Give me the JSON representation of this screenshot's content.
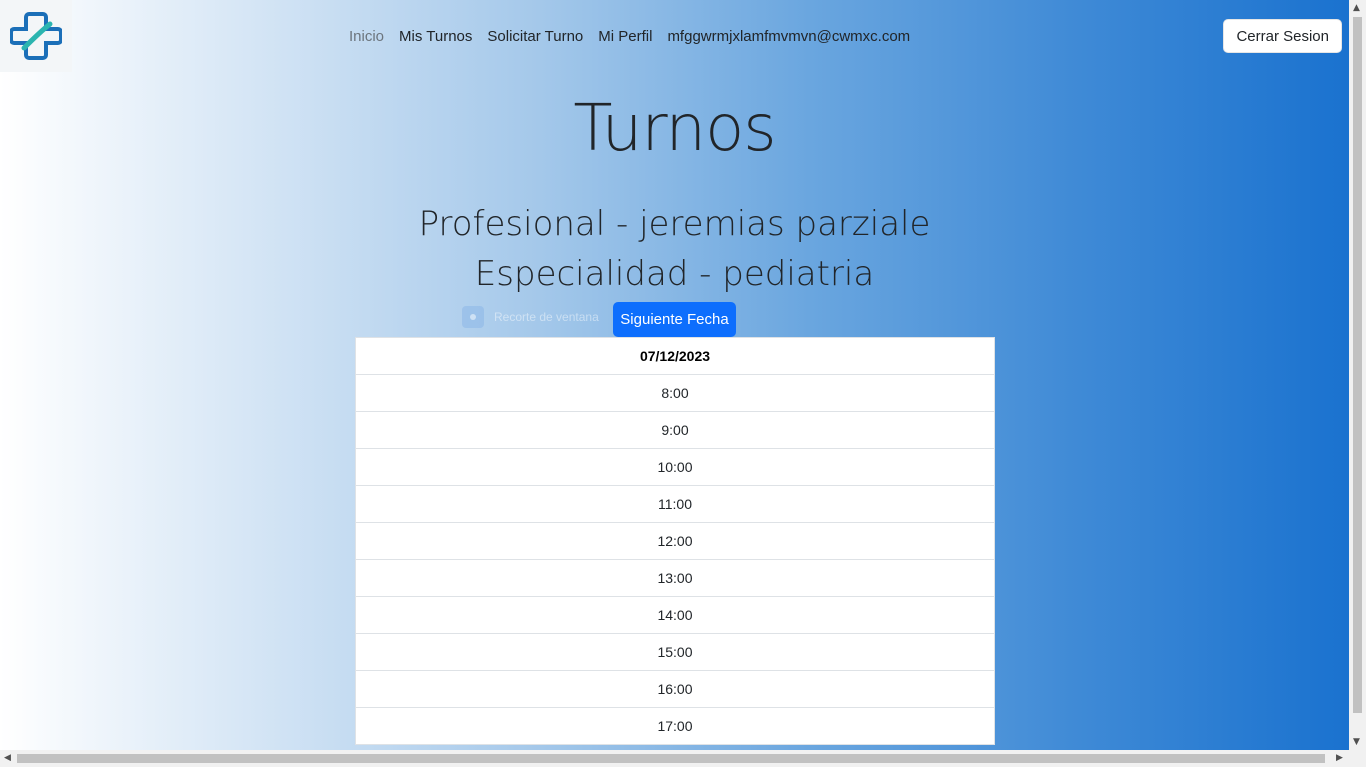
{
  "header": {
    "logo_icon": "medical-cross-icon",
    "nav": [
      {
        "label": "Inicio",
        "active": true
      },
      {
        "label": "Mis Turnos"
      },
      {
        "label": "Solicitar Turno"
      },
      {
        "label": "Mi Perfil"
      },
      {
        "label": "mfggwrmjxlamfmvmvn@cwmxc.com"
      }
    ],
    "logout_label": "Cerrar Sesion"
  },
  "main": {
    "title": "Turnos",
    "professional": "Profesional - jeremias parziale",
    "specialty": "Especialidad - pediatria",
    "ghost_overlay": "Recorte de ventana",
    "next_date_label": "Siguiente Fecha",
    "schedule": {
      "date": "07/12/2023",
      "slots": [
        "8:00",
        "9:00",
        "10:00",
        "11:00",
        "12:00",
        "13:00",
        "14:00",
        "15:00",
        "16:00",
        "17:00"
      ]
    }
  },
  "colors": {
    "primary_button": "#0d6efd",
    "gradient_end": "#1a72cf"
  }
}
